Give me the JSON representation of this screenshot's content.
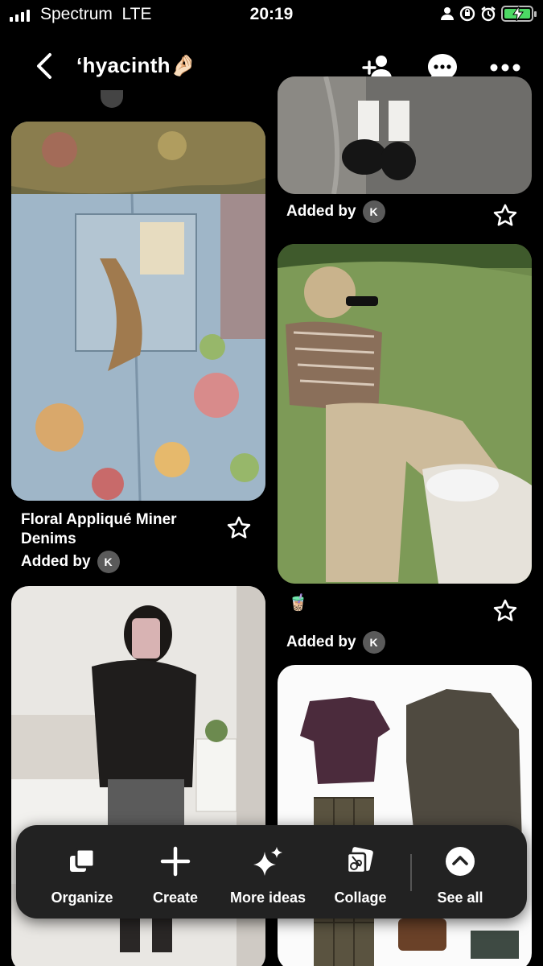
{
  "status_bar": {
    "carrier": "Spectrum",
    "network": "LTE",
    "time": "20:19",
    "battery_color": "#4cd964"
  },
  "header": {
    "board_title": "‘hyacinth🤌🏻",
    "icons": [
      "back-icon",
      "add-collaborator-icon",
      "message-icon",
      "more-icon"
    ]
  },
  "pins": {
    "p1": {
      "title": "Floral Appliqué Miner Denims",
      "added_by": "Added by",
      "avatar": "K"
    },
    "p2": {
      "added_by": "Added by",
      "avatar": "K"
    },
    "p3": {
      "note": "🧋",
      "added_by": "Added by",
      "avatar": "K"
    }
  },
  "toolbar": {
    "organize": "Organize",
    "create": "Create",
    "more_ideas": "More ideas",
    "collage": "Collage",
    "see_all": "See all"
  }
}
